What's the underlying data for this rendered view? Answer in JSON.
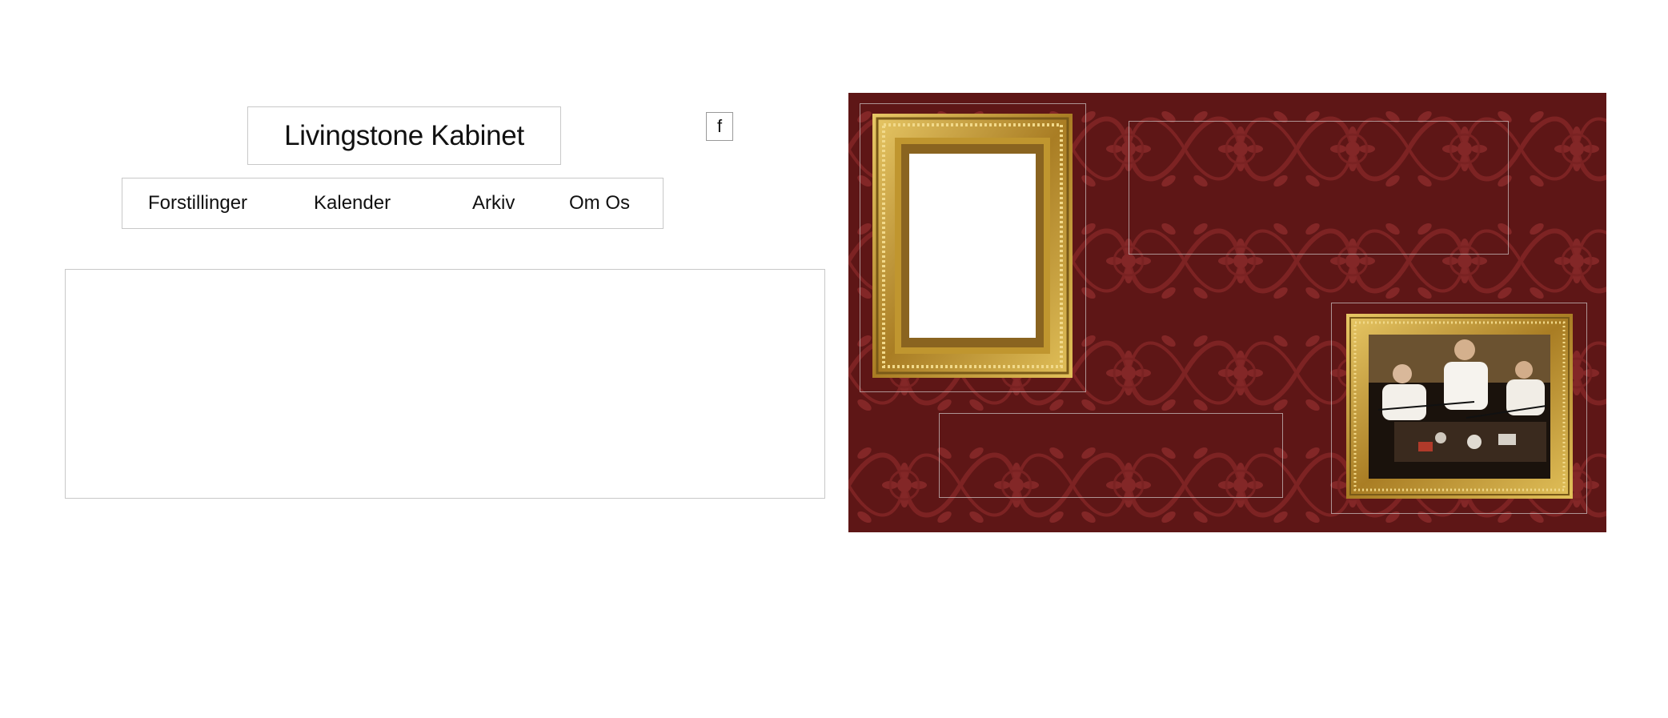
{
  "site": {
    "title": "Livingstone Kabinet",
    "facebook_label": "f"
  },
  "nav": {
    "items": [
      {
        "label": "Forstillinger"
      },
      {
        "label": "Kalender"
      },
      {
        "label": "Arkiv"
      },
      {
        "label": "Om Os"
      }
    ]
  },
  "colors": {
    "wallpaper": "#5e1616",
    "wallpaper_pattern": "#8a2a2a",
    "frame_gold": "#c9a244",
    "border_light": "#c8c8c8"
  },
  "gallery": {
    "frames": [
      {
        "name": "empty-gold-frame",
        "content": "blank"
      },
      {
        "name": "photo-gold-frame",
        "content": "photo of three performers at a table"
      }
    ]
  }
}
